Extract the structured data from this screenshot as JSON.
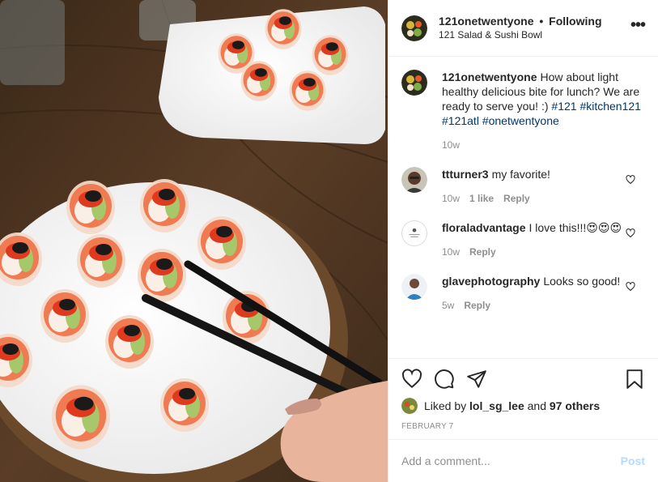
{
  "post": {
    "username": "121onetwentyone",
    "follow_separator": "•",
    "follow_label": "Following",
    "location": "121 Salad & Sushi Bowl",
    "more_label": "•••",
    "photo_alt": "Salmon and vegetable sushi rolls topped with tobiko on white plates with chopsticks"
  },
  "caption": {
    "username": "121onetwentyone",
    "text": "How about light healthy delicious bite for lunch? We are ready to serve you! :)",
    "hashtags": [
      "#121",
      "#kitchen121",
      "#121atl",
      "#onetwentyone"
    ],
    "age": "10w"
  },
  "comments": [
    {
      "username": "ttturner3",
      "text": "my favorite!",
      "age": "10w",
      "likes": "1 like",
      "reply": "Reply"
    },
    {
      "username": "floraladvantage",
      "text": "I love this!!!😍😍😍",
      "age": "10w",
      "likes": "",
      "reply": "Reply"
    },
    {
      "username": "glavephotography",
      "text": "Looks so good!",
      "age": "5w",
      "likes": "",
      "reply": "Reply"
    }
  ],
  "likes": {
    "prefix": "Liked by",
    "user": "lol_sg_lee",
    "middle": "and",
    "count": "97 others"
  },
  "date": "February 7",
  "add_comment": {
    "placeholder": "Add a comment...",
    "post_label": "Post"
  },
  "icons": {
    "like": "heart-icon",
    "comment": "comment-icon",
    "share": "share-icon",
    "save": "bookmark-icon",
    "comment_like": "heart-icon"
  },
  "colors": {
    "hashtag": "#00376b",
    "muted": "#8e8e8e",
    "post_button": "#b3dbff",
    "border": "#efefef"
  }
}
